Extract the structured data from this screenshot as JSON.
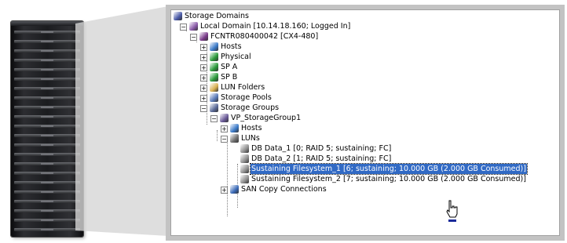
{
  "tree": {
    "nodes": [
      {
        "label": "Storage Domains",
        "icon": "storage-domains-icon",
        "color": "#4a5aa8"
      },
      {
        "label": "Local Domain [10.14.18.160; Logged In]",
        "icon": "local-domain-icon",
        "color": "#8a5aa8"
      },
      {
        "label": "FCNTR080400042 [CX4-480]",
        "icon": "storage-system-icon",
        "color": "#7a3a8a"
      },
      {
        "label": "Hosts",
        "icon": "hosts-icon",
        "color": "#3a7ac8"
      },
      {
        "label": "Physical",
        "icon": "physical-icon",
        "color": "#2a9a3a"
      },
      {
        "label": "SP A",
        "icon": "sp-icon",
        "color": "#2a9a3a"
      },
      {
        "label": "SP B",
        "icon": "sp-icon",
        "color": "#2a9a3a"
      },
      {
        "label": "LUN Folders",
        "icon": "folder-icon",
        "color": "#d8b050"
      },
      {
        "label": "Storage Pools",
        "icon": "storage-pools-icon",
        "color": "#5a7ab8"
      },
      {
        "label": "Storage Groups",
        "icon": "storage-groups-icon",
        "color": "#5a6a98"
      },
      {
        "label": "VP_StorageGroup1",
        "icon": "storage-group-icon",
        "color": "#6a5a98"
      },
      {
        "label": "Hosts",
        "icon": "hosts-icon",
        "color": "#3a7ac8"
      },
      {
        "label": "LUNs",
        "icon": "luns-icon",
        "color": "#707070"
      },
      {
        "label": "DB Data_1 [0; RAID 5; sustaining; FC]",
        "icon": "lun-icon",
        "color": "#909090"
      },
      {
        "label": "DB Data_2 [1; RAID 5; sustaining; FC]",
        "icon": "lun-icon",
        "color": "#909090"
      },
      {
        "label": "Sustaining Filesystem_1 [6; sustaining; 10.000 GB (2.000 GB Consumed)]",
        "icon": "thin-lun-icon",
        "color": "#909090"
      },
      {
        "label": "Sustaining Filesystem_2 [7; sustaining; 10.000 GB (2.000 GB Consumed)]",
        "icon": "thin-lun-icon",
        "color": "#909090"
      },
      {
        "label": "SAN Copy Connections",
        "icon": "san-copy-icon",
        "color": "#3a6ab8"
      }
    ]
  }
}
